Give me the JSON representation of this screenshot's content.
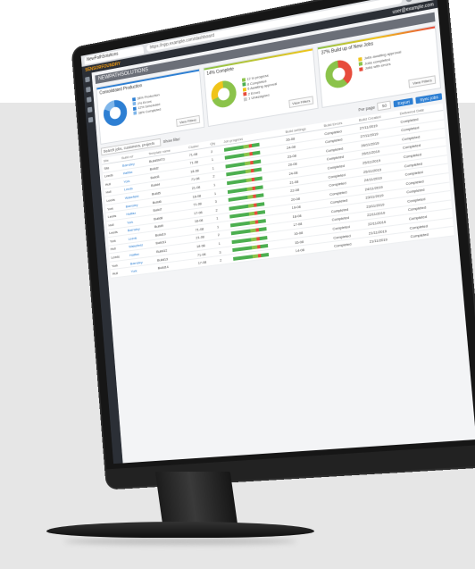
{
  "browser": {
    "tab_label": "NewPathSolutions",
    "address": "https://npp.example.com/dashboard",
    "icons": [
      "back-icon",
      "forward-icon",
      "reload-icon",
      "star-icon",
      "extensions-icon",
      "profile-icon"
    ]
  },
  "topbar": {
    "logo": "SENSORFOUNDRY",
    "right_text": "Search",
    "user": "user@example.com"
  },
  "appbar": {
    "title": "NEWPATHSOLUTIONS"
  },
  "cards": [
    {
      "title": "Consolidated Production",
      "accent": "#2d7fd3",
      "donut": {
        "a": "#2d7fd3",
        "b": "#7fb6ea",
        "split": 82
      },
      "legend": [
        "38% Production",
        "2% Errors",
        "12% Scheduled",
        "38% Completed"
      ],
      "button": "View Filters"
    },
    {
      "title": "14% Complete",
      "accent": "#f0c419",
      "donut": {
        "a": "#8bc34a",
        "b": "#f0c419",
        "split": 70
      },
      "legend": [
        "12 In progress",
        "8 Completed",
        "6 Awaiting approval",
        "2 Errors",
        "1 Unassigned"
      ],
      "button": "View Filters"
    },
    {
      "title": "37% Build up of New Jobs",
      "accent": "#e74c3c",
      "donut": {
        "a": "#e74c3c",
        "b": "#8bc34a",
        "split": 40
      },
      "legend": [
        "Jobs awaiting approval",
        "Jobs completed",
        "Jobs with errors"
      ],
      "button": "View Filters"
    }
  ],
  "toolbar": {
    "search_placeholder": "Search jobs, customers, projects",
    "page_label": "Per page",
    "page_value": "50",
    "show_label": "Show filter",
    "primary_btn": "Export",
    "secondary_btn": "Sync jobs"
  },
  "table": {
    "headers": [
      "Site",
      "Build ref",
      "Template name",
      "Cluster",
      "Qty",
      "Job progress",
      "Job Status",
      "Build settings",
      "Build Errors",
      "Build Created",
      "Delivered Date",
      "Time to finish"
    ],
    "rows": [
      [
        "Site",
        "Barnsley",
        "BuildSMT3",
        "71-08",
        "2",
        "",
        "",
        "26-08",
        "Completed",
        "27/11/2019",
        "Completed",
        ""
      ],
      [
        "Leeds",
        "Halifax",
        "Build2",
        "71-08",
        "1",
        "",
        "",
        "24-08",
        "Completed",
        "27/11/2019",
        "Completed",
        ""
      ],
      [
        "Hull",
        "York",
        "Build3",
        "18-08",
        "1",
        "",
        "",
        "23-08",
        "Completed",
        "26/11/2019",
        "Completed",
        ""
      ],
      [
        "Hull",
        "Leeds",
        "Build4",
        "71-08",
        "2",
        "",
        "",
        "20-08",
        "Completed",
        "26/11/2019",
        "Completed",
        ""
      ],
      [
        "Leeds",
        "Wakefield",
        "Build5",
        "21-08",
        "1",
        "",
        "",
        "24-08",
        "Completed",
        "25/11/2019",
        "Completed",
        ""
      ],
      [
        "York",
        "Barnsley",
        "Build6",
        "18-08",
        "1",
        "",
        "",
        "21-08",
        "Completed",
        "25/11/2019",
        "Completed",
        ""
      ],
      [
        "Leeds",
        "Halifax",
        "Build7",
        "71-08",
        "3",
        "",
        "",
        "22-08",
        "Completed",
        "24/11/2019",
        "Completed",
        ""
      ],
      [
        "Hull",
        "York",
        "Build8",
        "17-08",
        "2",
        "",
        "",
        "20-08",
        "Completed",
        "24/11/2019",
        "Completed",
        ""
      ],
      [
        "Leeds",
        "Barnsley",
        "Build9",
        "18-08",
        "1",
        "",
        "",
        "19-08",
        "Completed",
        "23/11/2019",
        "Completed",
        ""
      ],
      [
        "York",
        "Leeds",
        "Build10",
        "71-08",
        "1",
        "",
        "",
        "18-08",
        "Completed",
        "23/11/2019",
        "Completed",
        ""
      ],
      [
        "Hull",
        "Wakefield",
        "Build11",
        "21-08",
        "2",
        "",
        "",
        "17-08",
        "Completed",
        "22/11/2019",
        "Completed",
        ""
      ],
      [
        "Leeds",
        "Halifax",
        "Build12",
        "18-08",
        "1",
        "",
        "",
        "16-08",
        "Completed",
        "22/11/2019",
        "Completed",
        ""
      ],
      [
        "York",
        "Barnsley",
        "Build13",
        "71-08",
        "3",
        "",
        "",
        "15-08",
        "Completed",
        "21/11/2019",
        "Completed",
        ""
      ],
      [
        "Hull",
        "York",
        "Build14",
        "17-08",
        "2",
        "",
        "",
        "14-08",
        "Completed",
        "21/11/2019",
        "Completed",
        ""
      ]
    ]
  }
}
